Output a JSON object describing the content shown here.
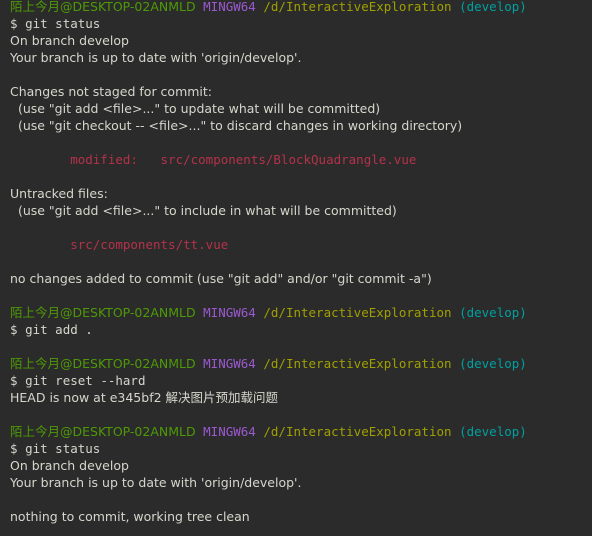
{
  "terminal": {
    "app": "MINGW64 Git Bash",
    "background_color": "#2b2b2b",
    "foreground_color": "#d6d6cc",
    "colors": {
      "user_host": "#4e9a06",
      "mingw": "#9b59d0",
      "path": "#a0a000",
      "branch": "#00a0a0",
      "modified_red": "#b4324a",
      "default_text": "#d6d6cc"
    },
    "prompt": {
      "user_host": "陌上今月@DESKTOP-02ANMLD",
      "shell": "MINGW64",
      "cwd": "/d/InteractiveExploration",
      "branch": "(develop)",
      "symbol": "$"
    },
    "lines": [
      {
        "id": "l01",
        "type": "prompt"
      },
      {
        "id": "l02",
        "type": "command",
        "text": "git status"
      },
      {
        "id": "l03",
        "type": "text",
        "text": "On branch develop"
      },
      {
        "id": "l04",
        "type": "text",
        "text": "Your branch is up to date with 'origin/develop'."
      },
      {
        "id": "l05",
        "type": "blank"
      },
      {
        "id": "l06",
        "type": "text",
        "text": "Changes not staged for commit:"
      },
      {
        "id": "l07",
        "type": "text",
        "text": "  (use \"git add <file>...\" to update what will be committed)"
      },
      {
        "id": "l08",
        "type": "text",
        "text": "  (use \"git checkout -- <file>...\" to discard changes in working directory)"
      },
      {
        "id": "l09",
        "type": "blank"
      },
      {
        "id": "l10",
        "type": "red",
        "text": "        modified:   src/components/BlockQuadrangle.vue"
      },
      {
        "id": "l11",
        "type": "blank"
      },
      {
        "id": "l12",
        "type": "text",
        "text": "Untracked files:"
      },
      {
        "id": "l13",
        "type": "text",
        "text": "  (use \"git add <file>...\" to include in what will be committed)"
      },
      {
        "id": "l14",
        "type": "blank"
      },
      {
        "id": "l15",
        "type": "red",
        "text": "        src/components/tt.vue"
      },
      {
        "id": "l16",
        "type": "blank"
      },
      {
        "id": "l17",
        "type": "text",
        "text": "no changes added to commit (use \"git add\" and/or \"git commit -a\")"
      },
      {
        "id": "l18",
        "type": "blank"
      },
      {
        "id": "l19",
        "type": "prompt"
      },
      {
        "id": "l20",
        "type": "command",
        "text": "git add ."
      },
      {
        "id": "l21",
        "type": "blank"
      },
      {
        "id": "l22",
        "type": "prompt"
      },
      {
        "id": "l23",
        "type": "command",
        "text": "git reset --hard"
      },
      {
        "id": "l24",
        "type": "text",
        "text": "HEAD is now at e345bf2 解决图片预加载问题"
      },
      {
        "id": "l25",
        "type": "blank"
      },
      {
        "id": "l26",
        "type": "prompt"
      },
      {
        "id": "l27",
        "type": "command",
        "text": "git status"
      },
      {
        "id": "l28",
        "type": "text",
        "text": "On branch develop"
      },
      {
        "id": "l29",
        "type": "text",
        "text": "Your branch is up to date with 'origin/develop'."
      },
      {
        "id": "l30",
        "type": "blank"
      },
      {
        "id": "l31",
        "type": "text",
        "text": "nothing to commit, working tree clean"
      }
    ]
  }
}
